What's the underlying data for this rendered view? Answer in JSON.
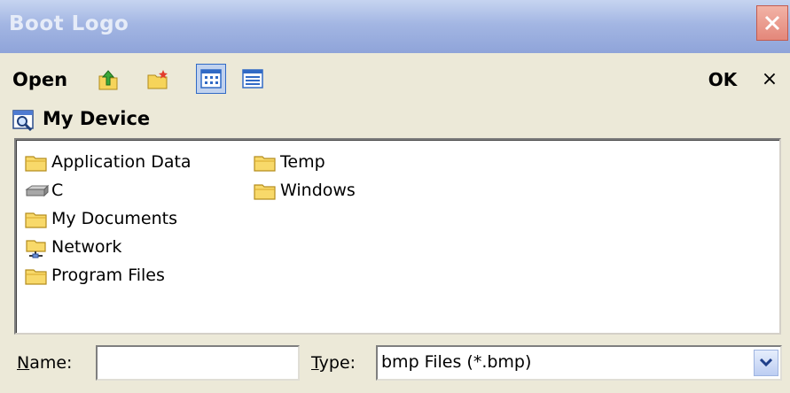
{
  "window": {
    "title": "Boot Logo",
    "close_icon": "close-icon"
  },
  "toolbar": {
    "open_label": "Open",
    "up_icon": "up-folder-icon",
    "new_folder_icon": "new-folder-icon",
    "list_view_icon": "list-view-icon",
    "details_view_icon": "details-view-icon",
    "ok_label": "OK",
    "cancel_label": "×"
  },
  "location": {
    "icon": "my-device-icon",
    "label": "My Device"
  },
  "files": [
    {
      "name": "Application Data",
      "icon": "folder-icon"
    },
    {
      "name": "C",
      "icon": "drive-icon"
    },
    {
      "name": "My Documents",
      "icon": "folder-icon"
    },
    {
      "name": "Network",
      "icon": "network-icon"
    },
    {
      "name": "Program Files",
      "icon": "folder-icon"
    },
    {
      "name": "Temp",
      "icon": "folder-icon"
    },
    {
      "name": "Windows",
      "icon": "folder-icon"
    }
  ],
  "bottom": {
    "name_label_accel": "N",
    "name_label_rest": "ame:",
    "name_value": "",
    "type_label_accel": "T",
    "type_label_rest": "ype:",
    "type_value": "bmp  Files (*.bmp)"
  },
  "colors": {
    "title_gradient_top": "#c6d4f0",
    "title_gradient_bottom": "#8fa4d9",
    "face": "#ece9d8",
    "close_button": "#e3877a"
  }
}
